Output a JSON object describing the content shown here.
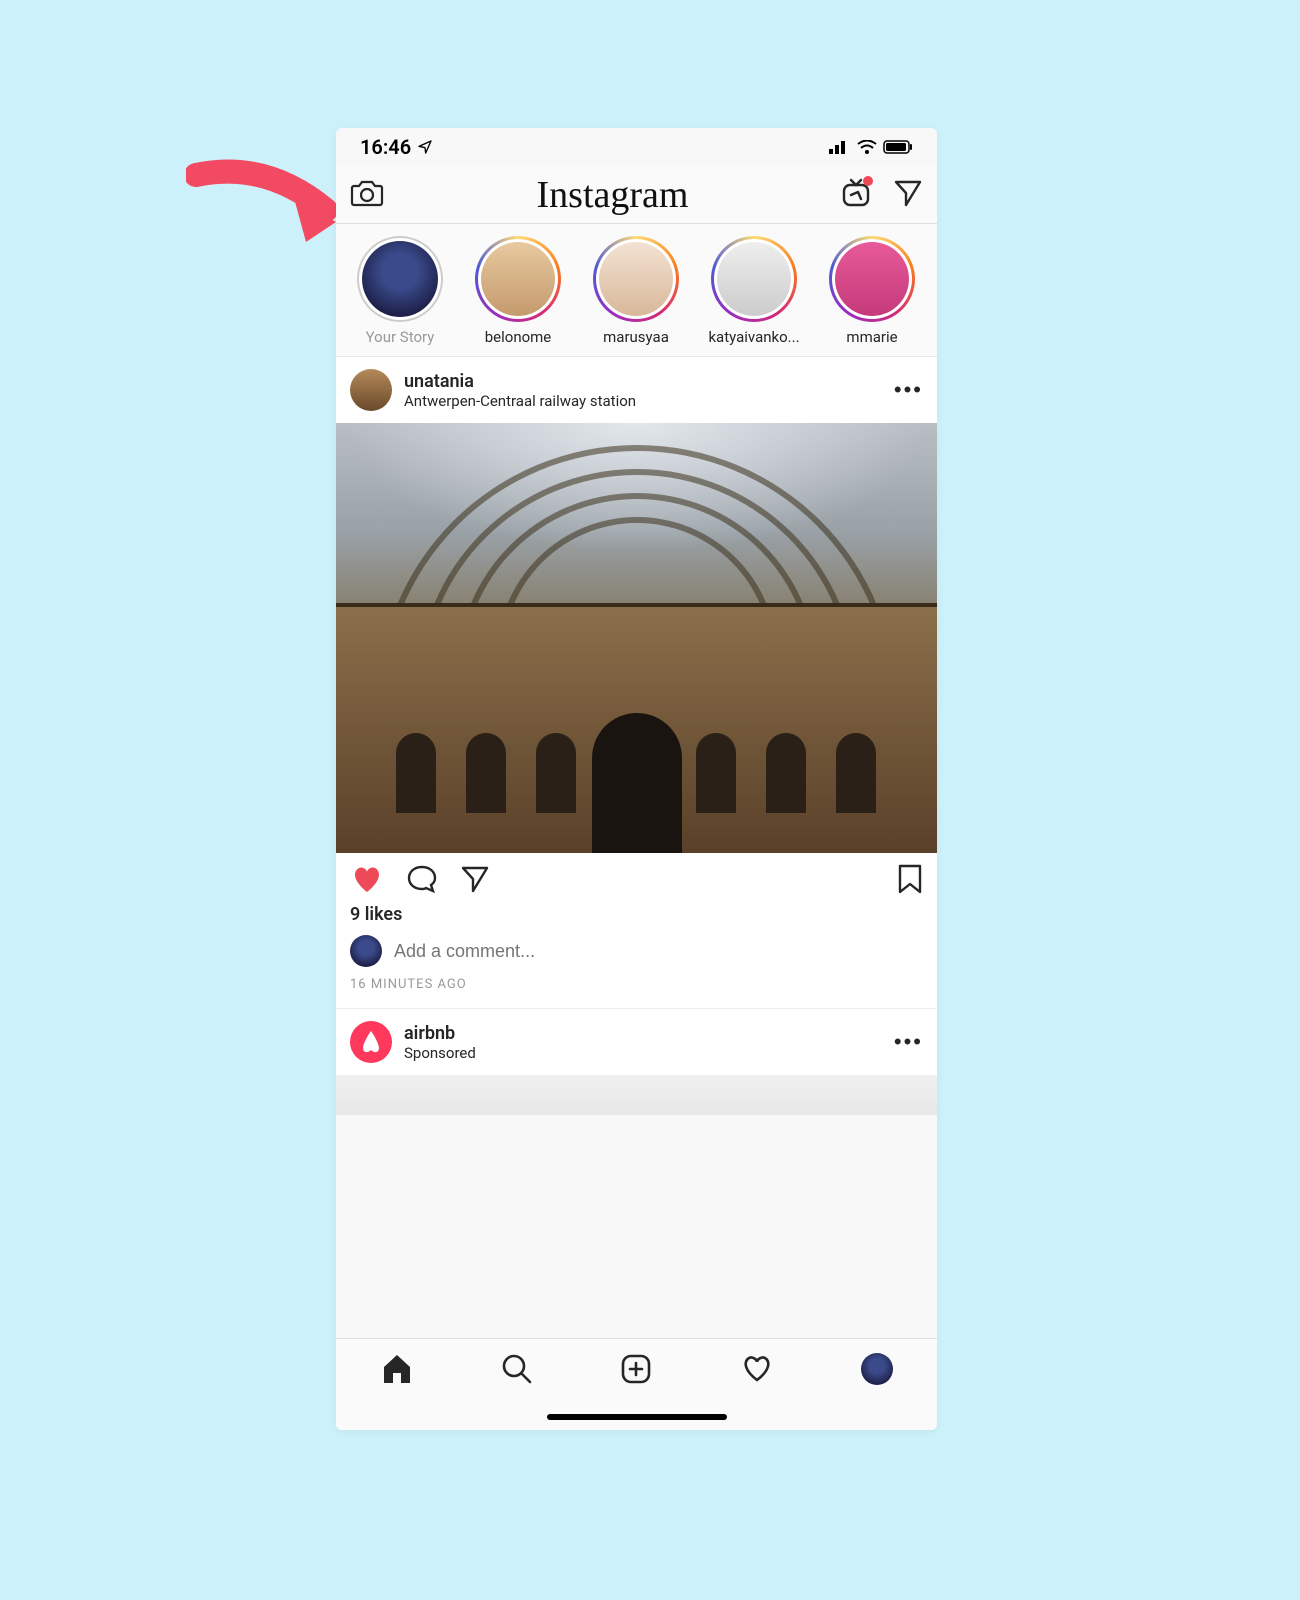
{
  "status": {
    "time": "16:46"
  },
  "topnav": {
    "brand": "Instagram",
    "camera_icon": "camera-icon",
    "igtv_icon": "igtv-icon",
    "igtv_has_notification": true,
    "dm_icon": "paper-plane-icon"
  },
  "stories": [
    {
      "label": "Your Story",
      "own": true,
      "avatarClass": "av-0"
    },
    {
      "label": "belonome",
      "own": false,
      "avatarClass": "av-1"
    },
    {
      "label": "marusyaa",
      "own": false,
      "avatarClass": "av-2"
    },
    {
      "label": "katyaivanko...",
      "own": false,
      "avatarClass": "av-3"
    },
    {
      "label": "mmarie",
      "own": false,
      "avatarClass": "av-4"
    }
  ],
  "post": {
    "author": "unatania",
    "location": "Antwerpen-Centraal railway station",
    "likes_text": "9 likes",
    "comment_placeholder": "Add a comment...",
    "timestamp": "16 MINUTES AGO",
    "liked": true
  },
  "sponsored": {
    "name": "airbnb",
    "sub": "Sponsored"
  },
  "colors": {
    "like_active": "#ed4956",
    "airbnb": "#ff385c",
    "arrow": "#f24a62"
  }
}
